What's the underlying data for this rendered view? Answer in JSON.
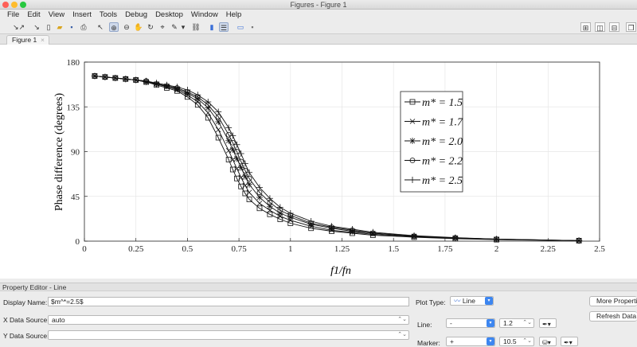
{
  "window": {
    "title": "Figures - Figure 1"
  },
  "menu": [
    "File",
    "Edit",
    "View",
    "Insert",
    "Tools",
    "Debug",
    "Desktop",
    "Window",
    "Help"
  ],
  "tab": {
    "label": "Figure 1"
  },
  "chart_data": {
    "type": "line",
    "xlabel": "f1/fn",
    "ylabel": "Phase difference (degrees)",
    "xlim": [
      0,
      2.5
    ],
    "ylim": [
      0,
      180
    ],
    "xticks": [
      "0",
      "0.25",
      "0.5",
      "0.75",
      "1",
      "1.25",
      "1.5",
      "1.75",
      "2",
      "2.25",
      "2.5"
    ],
    "yticks": [
      "0",
      "45",
      "90",
      "135",
      "180"
    ],
    "grid": true,
    "legend_position": "upper-right",
    "series": [
      {
        "name": "m* = 1.5",
        "marker": "square",
        "x": [
          0.05,
          0.1,
          0.15,
          0.2,
          0.25,
          0.3,
          0.35,
          0.4,
          0.45,
          0.5,
          0.55,
          0.6,
          0.65,
          0.7,
          0.72,
          0.74,
          0.76,
          0.78,
          0.8,
          0.85,
          0.9,
          0.95,
          1.0,
          1.1,
          1.2,
          1.3,
          1.4,
          1.6,
          1.8,
          2.0,
          2.4
        ],
        "y": [
          166,
          165,
          164,
          163,
          162,
          160,
          157,
          154,
          151,
          145,
          137,
          124,
          104,
          82,
          72,
          63,
          55,
          48,
          42,
          33,
          27,
          22,
          18,
          13,
          10,
          8,
          6,
          4,
          2.5,
          1.5,
          0.5
        ]
      },
      {
        "name": "m* = 1.7",
        "marker": "x",
        "x": [
          0.05,
          0.1,
          0.15,
          0.2,
          0.25,
          0.3,
          0.35,
          0.4,
          0.45,
          0.5,
          0.55,
          0.6,
          0.65,
          0.7,
          0.72,
          0.74,
          0.76,
          0.78,
          0.8,
          0.85,
          0.9,
          0.95,
          1.0,
          1.1,
          1.2,
          1.3,
          1.4,
          1.6,
          1.8,
          2.0,
          2.4
        ],
        "y": [
          166,
          165,
          164,
          163,
          162,
          160,
          158,
          155,
          152,
          147,
          140,
          129,
          112,
          91,
          82,
          73,
          64,
          56,
          49,
          38,
          31,
          25,
          21,
          15,
          11,
          9,
          7,
          4.5,
          3,
          1.8,
          0.5
        ]
      },
      {
        "name": "m* = 2.0",
        "marker": "star",
        "x": [
          0.05,
          0.1,
          0.15,
          0.2,
          0.25,
          0.3,
          0.35,
          0.4,
          0.45,
          0.5,
          0.55,
          0.6,
          0.65,
          0.7,
          0.72,
          0.74,
          0.76,
          0.78,
          0.8,
          0.85,
          0.9,
          0.95,
          1.0,
          1.1,
          1.2,
          1.3,
          1.4,
          1.6,
          1.8,
          2.0,
          2.4
        ],
        "y": [
          166,
          165,
          164,
          163,
          162,
          160,
          158,
          156,
          153,
          149,
          143,
          134,
          120,
          101,
          92,
          83,
          74,
          65,
          57,
          44,
          35,
          28,
          24,
          17,
          13,
          10,
          8,
          5,
          3.2,
          2,
          0.6
        ]
      },
      {
        "name": "m* = 2.2",
        "marker": "circle",
        "x": [
          0.05,
          0.1,
          0.15,
          0.2,
          0.25,
          0.3,
          0.35,
          0.4,
          0.45,
          0.5,
          0.55,
          0.6,
          0.65,
          0.7,
          0.72,
          0.74,
          0.76,
          0.78,
          0.8,
          0.85,
          0.9,
          0.95,
          1.0,
          1.1,
          1.2,
          1.3,
          1.4,
          1.6,
          1.8,
          2.0,
          2.4
        ],
        "y": [
          166,
          165,
          164,
          163,
          162,
          161,
          158,
          156,
          154,
          150,
          145,
          137,
          125,
          107,
          99,
          90,
          80,
          71,
          63,
          49,
          39,
          31,
          26,
          18,
          14,
          11,
          8,
          5,
          3.3,
          2,
          0.6
        ]
      },
      {
        "name": "m* = 2.5",
        "marker": "plus",
        "x": [
          0.05,
          0.1,
          0.15,
          0.2,
          0.25,
          0.3,
          0.35,
          0.4,
          0.45,
          0.5,
          0.55,
          0.6,
          0.65,
          0.7,
          0.72,
          0.74,
          0.76,
          0.78,
          0.8,
          0.85,
          0.9,
          0.95,
          1.0,
          1.1,
          1.2,
          1.3,
          1.4,
          1.6,
          1.8,
          2.0,
          2.4
        ],
        "y": [
          166,
          165,
          164,
          163,
          162,
          161,
          159,
          157,
          155,
          152,
          147,
          140,
          130,
          114,
          106,
          97,
          88,
          78,
          69,
          54,
          43,
          34,
          28,
          20,
          15,
          12,
          9,
          5.5,
          3.5,
          2.1,
          0.6
        ]
      }
    ]
  },
  "property_editor": {
    "header": "Property Editor - Line",
    "display_name_label": "Display Name:",
    "display_name_value": "$m^*=2.5$",
    "x_source_label": "X Data Source:",
    "x_source_value": "auto",
    "y_source_label": "Y Data Source:",
    "y_source_value": "",
    "plot_type_label": "Plot Type:",
    "plot_type_value": "Line",
    "line_label": "Line:",
    "line_style": "-",
    "line_width": "1.2",
    "marker_label": "Marker:",
    "marker_value": "+",
    "marker_size": "10.5",
    "more_properties": "More Properties",
    "refresh_data": "Refresh Data"
  }
}
